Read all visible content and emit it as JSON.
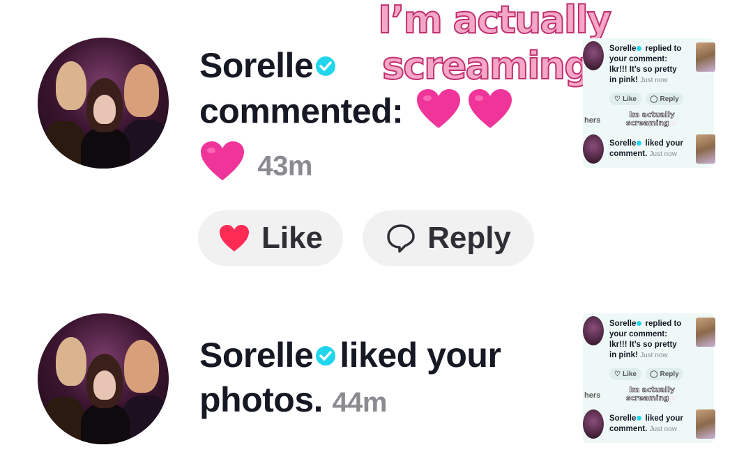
{
  "notification1": {
    "username": "Sorelle",
    "action": "commented:",
    "time": "43m",
    "like_label": "Like",
    "reply_label": "Reply"
  },
  "notification2": {
    "username": "Sorelle",
    "action": "liked your",
    "action2": "photos.",
    "time": "44m"
  },
  "overlay": {
    "line1": "I’m actually",
    "line2": "screaming"
  },
  "mini_panel": {
    "reply_user": "Sorelle",
    "reply_text1": " replied to",
    "reply_text2": "your comment:",
    "reply_text3": "Ikr!!! It’s so pretty",
    "reply_text4": "in pink!",
    "reply_time": "Just now",
    "like_label": "Like",
    "reply_label": "Reply",
    "hers_label": "hers",
    "caption1": "Im actually",
    "caption2": "screaming",
    "caption_emoji": "😭",
    "liked_user": "Sorelle",
    "liked_text1": " liked your",
    "liked_text2": "comment.",
    "liked_time": "Just now"
  },
  "colors": {
    "verified": "#20d5ec",
    "heart_red": "#fe2c55",
    "emoji_heart": "#f0359a",
    "overlay_fill": "#f5a7c8",
    "overlay_stroke": "#c0306f"
  }
}
